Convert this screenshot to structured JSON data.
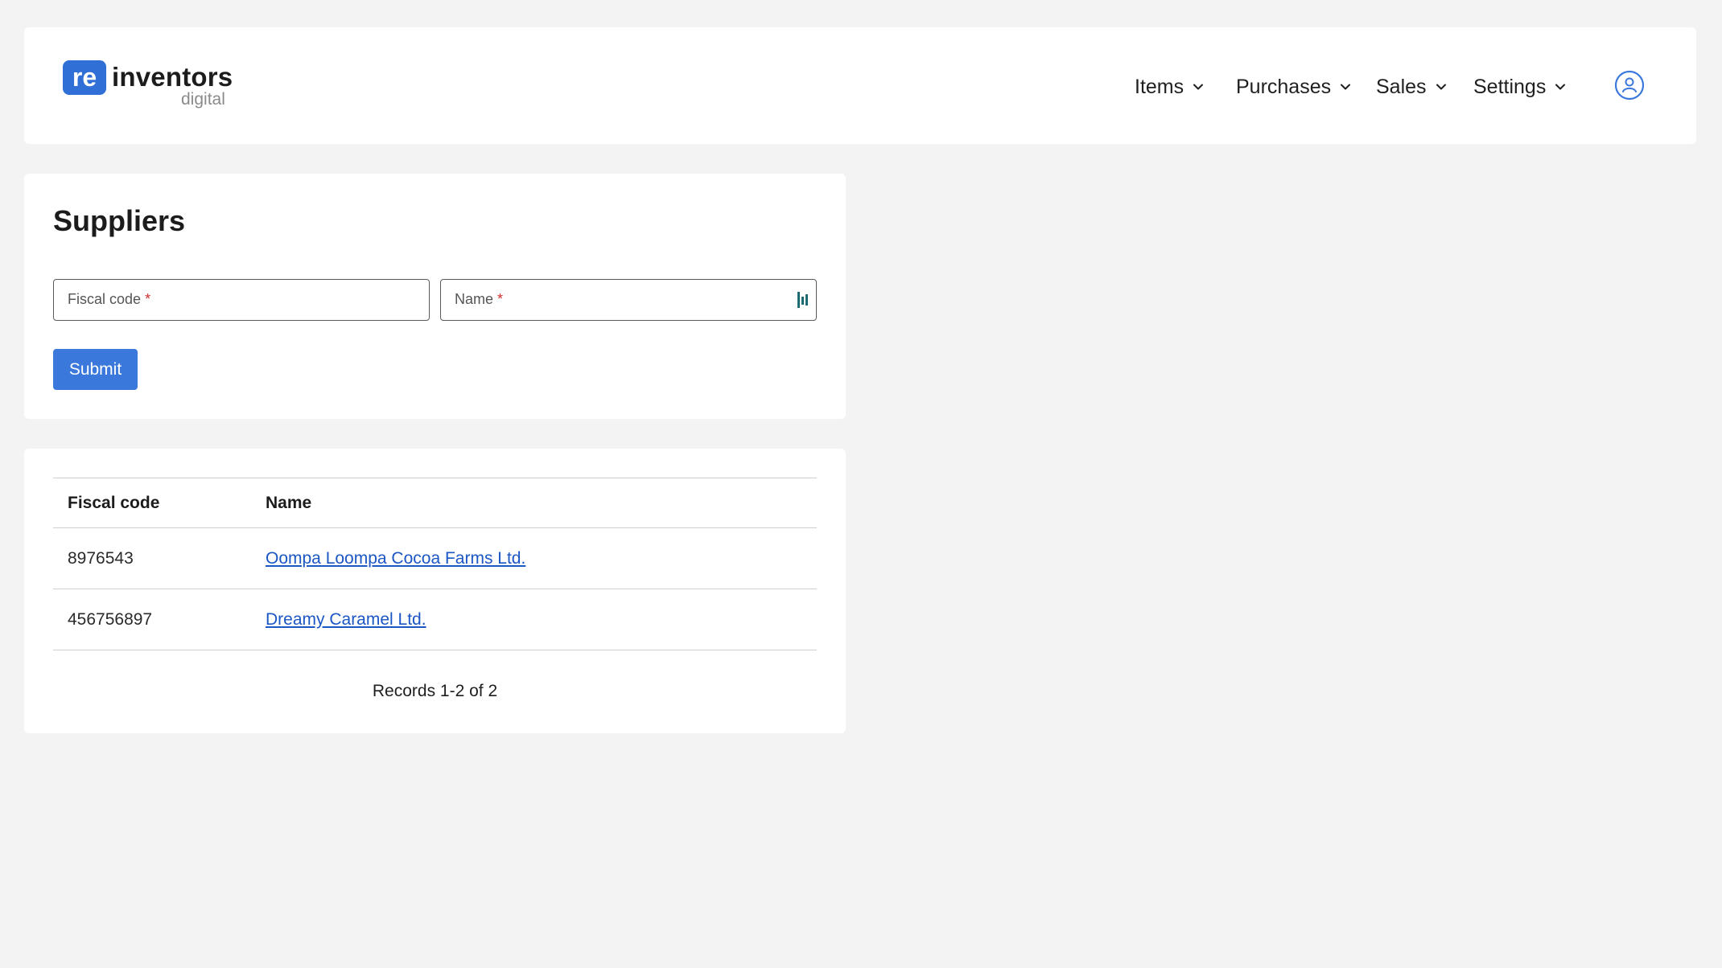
{
  "header": {
    "logo": {
      "badge": "re",
      "word": "inventors",
      "sub": "digital"
    },
    "nav": [
      {
        "label": "Items"
      },
      {
        "label": "Purchases"
      },
      {
        "label": "Sales"
      },
      {
        "label": "Settings"
      }
    ],
    "user_icon": "user-circle-icon"
  },
  "form": {
    "title": "Suppliers",
    "fiscal_code": {
      "placeholder": "Fiscal code",
      "required_mark": "*",
      "value": ""
    },
    "name": {
      "placeholder": "Name",
      "required_mark": "*",
      "value": ""
    },
    "submit_label": "Submit"
  },
  "table": {
    "columns": [
      "Fiscal code",
      "Name"
    ],
    "rows": [
      {
        "fiscal_code": "8976543",
        "name": "Oompa Loompa Cocoa Farms Ltd."
      },
      {
        "fiscal_code": "456756897",
        "name": "Dreamy Caramel Ltd."
      }
    ],
    "records": "Records 1-2 of 2"
  },
  "colors": {
    "accent": "#3b78dc",
    "link": "#1a56c4",
    "required": "#d22d2d"
  }
}
